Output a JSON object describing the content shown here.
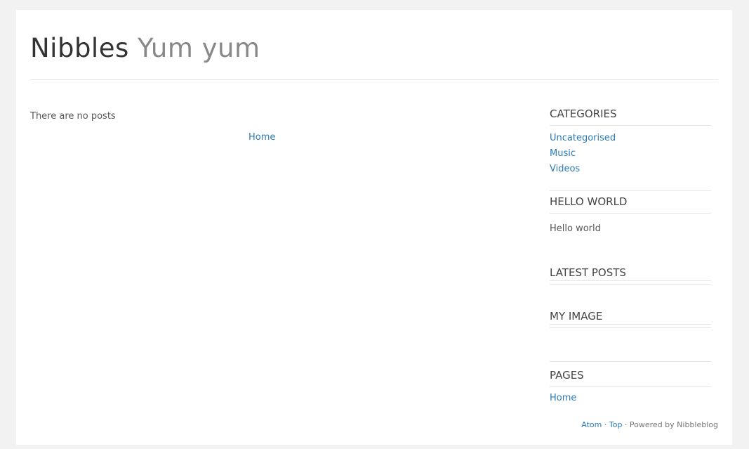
{
  "site": {
    "name": "Nibbles",
    "slogan": "Yum yum"
  },
  "main": {
    "no_posts_text": "There are no posts",
    "pager_home_label": "Home"
  },
  "sidebar": {
    "categories": {
      "title": "CATEGORIES",
      "items": [
        "Uncategorised",
        "Music",
        "Videos"
      ]
    },
    "hello_world": {
      "title": "HELLO WORLD",
      "text": "Hello world"
    },
    "latest_posts": {
      "title": "LATEST POSTS"
    },
    "my_image": {
      "title": "MY IMAGE"
    },
    "pages": {
      "title": "PAGES",
      "items": [
        "Home"
      ]
    }
  },
  "footer": {
    "atom_label": "Atom",
    "separator_1": "·",
    "top_label": "Top",
    "powered_text": "· Powered by Nibbleblog"
  },
  "colors": {
    "link": "#2a7ab8",
    "background": "#f2f2f2",
    "panel": "#ffffff"
  }
}
